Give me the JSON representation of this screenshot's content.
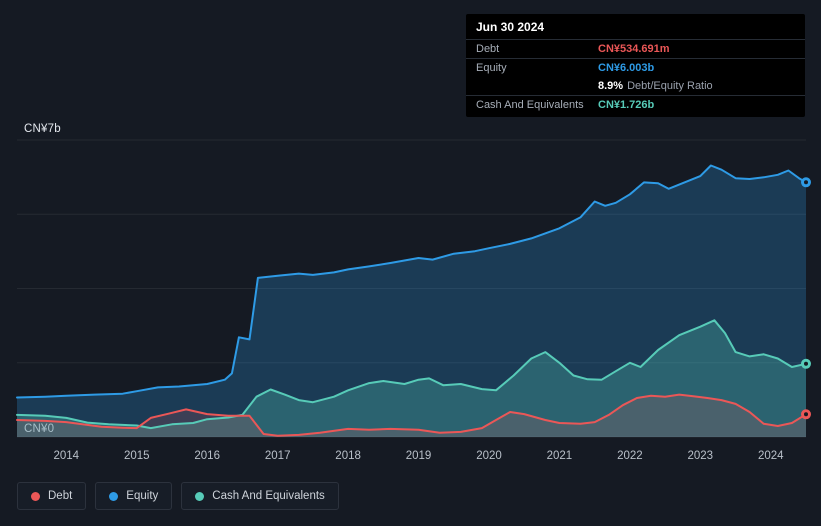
{
  "colors": {
    "background": "#151a23",
    "debt": "#eb5757",
    "equity": "#2e9be6",
    "cash": "#57cbb8",
    "grid": "rgba(255,255,255,0.07)",
    "tooltip_bg": "#000000",
    "tooltip_divider": "#262c35",
    "text_primary": "#ffffff",
    "text_muted": "#a7aeb8"
  },
  "tooltip": {
    "date": "Jun 30 2024",
    "rows": [
      {
        "label": "Debt",
        "value": "CN¥534.691m",
        "color_key": "debt"
      },
      {
        "label": "Equity",
        "value": "CN¥6.003b",
        "color_key": "equity"
      },
      {
        "label": "Cash And Equivalents",
        "value": "CN¥1.726b",
        "color_key": "cash"
      }
    ],
    "ratio_value": "8.9%",
    "ratio_label": "Debt/Equity Ratio"
  },
  "y_axis": {
    "top_label": "CN¥7b",
    "bottom_label": "CN¥0"
  },
  "legend": [
    {
      "label": "Debt",
      "color_key": "debt"
    },
    {
      "label": "Equity",
      "color_key": "equity"
    },
    {
      "label": "Cash And Equivalents",
      "color_key": "cash"
    }
  ],
  "chart_data": {
    "type": "area",
    "value_unit": "CN¥ billions",
    "x_range": [
      2013.3,
      2024.5
    ],
    "ylim": [
      0,
      7
    ],
    "gridline_values": [
      0,
      1.75,
      3.5,
      5.25,
      7
    ],
    "x_ticks": [
      2014,
      2015,
      2016,
      2017,
      2018,
      2019,
      2020,
      2021,
      2022,
      2023,
      2024
    ],
    "legend_position": "bottom-left",
    "series": [
      {
        "key": "equity",
        "name": "Equity",
        "color": "#2e9be6",
        "fill": "rgba(46,155,230,0.26)",
        "last_value_label": "CN¥6.003b",
        "points": [
          [
            2013.3,
            0.93
          ],
          [
            2013.7,
            0.95
          ],
          [
            2014.0,
            0.97
          ],
          [
            2014.4,
            1.0
          ],
          [
            2014.8,
            1.02
          ],
          [
            2015.0,
            1.08
          ],
          [
            2015.3,
            1.17
          ],
          [
            2015.6,
            1.19
          ],
          [
            2016.0,
            1.25
          ],
          [
            2016.25,
            1.35
          ],
          [
            2016.35,
            1.5
          ],
          [
            2016.45,
            2.35
          ],
          [
            2016.6,
            2.3
          ],
          [
            2016.72,
            3.75
          ],
          [
            2017.0,
            3.8
          ],
          [
            2017.3,
            3.85
          ],
          [
            2017.5,
            3.82
          ],
          [
            2017.8,
            3.88
          ],
          [
            2018.0,
            3.95
          ],
          [
            2018.3,
            4.02
          ],
          [
            2018.6,
            4.1
          ],
          [
            2019.0,
            4.22
          ],
          [
            2019.2,
            4.18
          ],
          [
            2019.5,
            4.32
          ],
          [
            2019.8,
            4.38
          ],
          [
            2020.0,
            4.45
          ],
          [
            2020.3,
            4.55
          ],
          [
            2020.6,
            4.68
          ],
          [
            2021.0,
            4.92
          ],
          [
            2021.3,
            5.18
          ],
          [
            2021.5,
            5.55
          ],
          [
            2021.65,
            5.45
          ],
          [
            2021.8,
            5.52
          ],
          [
            2022.0,
            5.72
          ],
          [
            2022.2,
            6.0
          ],
          [
            2022.4,
            5.98
          ],
          [
            2022.55,
            5.85
          ],
          [
            2022.7,
            5.95
          ],
          [
            2023.0,
            6.15
          ],
          [
            2023.15,
            6.4
          ],
          [
            2023.3,
            6.3
          ],
          [
            2023.5,
            6.1
          ],
          [
            2023.7,
            6.08
          ],
          [
            2023.9,
            6.12
          ],
          [
            2024.1,
            6.18
          ],
          [
            2024.25,
            6.28
          ],
          [
            2024.4,
            6.1
          ],
          [
            2024.5,
            6.003
          ]
        ]
      },
      {
        "key": "cash",
        "name": "Cash And Equivalents",
        "color": "#57cbb8",
        "fill": "rgba(87,203,184,0.28)",
        "last_value_label": "CN¥1.726b",
        "points": [
          [
            2013.3,
            0.52
          ],
          [
            2013.7,
            0.5
          ],
          [
            2014.0,
            0.45
          ],
          [
            2014.3,
            0.34
          ],
          [
            2014.6,
            0.3
          ],
          [
            2015.0,
            0.27
          ],
          [
            2015.2,
            0.21
          ],
          [
            2015.5,
            0.3
          ],
          [
            2015.8,
            0.33
          ],
          [
            2016.0,
            0.42
          ],
          [
            2016.3,
            0.46
          ],
          [
            2016.5,
            0.52
          ],
          [
            2016.7,
            0.95
          ],
          [
            2016.9,
            1.12
          ],
          [
            2017.1,
            1.0
          ],
          [
            2017.3,
            0.87
          ],
          [
            2017.5,
            0.82
          ],
          [
            2017.8,
            0.95
          ],
          [
            2018.0,
            1.1
          ],
          [
            2018.3,
            1.27
          ],
          [
            2018.5,
            1.32
          ],
          [
            2018.8,
            1.25
          ],
          [
            2019.0,
            1.35
          ],
          [
            2019.15,
            1.38
          ],
          [
            2019.35,
            1.22
          ],
          [
            2019.6,
            1.25
          ],
          [
            2019.9,
            1.13
          ],
          [
            2020.1,
            1.1
          ],
          [
            2020.35,
            1.45
          ],
          [
            2020.6,
            1.85
          ],
          [
            2020.8,
            2.0
          ],
          [
            2021.0,
            1.75
          ],
          [
            2021.2,
            1.45
          ],
          [
            2021.4,
            1.36
          ],
          [
            2021.6,
            1.35
          ],
          [
            2021.8,
            1.55
          ],
          [
            2022.0,
            1.75
          ],
          [
            2022.15,
            1.65
          ],
          [
            2022.4,
            2.05
          ],
          [
            2022.7,
            2.4
          ],
          [
            2023.0,
            2.6
          ],
          [
            2023.2,
            2.75
          ],
          [
            2023.35,
            2.45
          ],
          [
            2023.5,
            2.0
          ],
          [
            2023.7,
            1.9
          ],
          [
            2023.9,
            1.95
          ],
          [
            2024.1,
            1.85
          ],
          [
            2024.3,
            1.65
          ],
          [
            2024.5,
            1.726
          ]
        ]
      },
      {
        "key": "debt",
        "name": "Debt",
        "color": "#eb5757",
        "fill": "rgba(235,87,87,0.16)",
        "last_value_label": "CN¥534.691m",
        "points": [
          [
            2013.3,
            0.4
          ],
          [
            2013.7,
            0.38
          ],
          [
            2014.0,
            0.35
          ],
          [
            2014.5,
            0.24
          ],
          [
            2014.8,
            0.22
          ],
          [
            2015.0,
            0.21
          ],
          [
            2015.2,
            0.45
          ],
          [
            2015.45,
            0.55
          ],
          [
            2015.7,
            0.65
          ],
          [
            2016.0,
            0.54
          ],
          [
            2016.3,
            0.5
          ],
          [
            2016.6,
            0.5
          ],
          [
            2016.8,
            0.07
          ],
          [
            2017.0,
            0.03
          ],
          [
            2017.3,
            0.05
          ],
          [
            2017.6,
            0.1
          ],
          [
            2018.0,
            0.19
          ],
          [
            2018.3,
            0.17
          ],
          [
            2018.6,
            0.19
          ],
          [
            2019.0,
            0.17
          ],
          [
            2019.3,
            0.1
          ],
          [
            2019.6,
            0.12
          ],
          [
            2019.9,
            0.21
          ],
          [
            2020.1,
            0.4
          ],
          [
            2020.3,
            0.59
          ],
          [
            2020.5,
            0.54
          ],
          [
            2020.8,
            0.4
          ],
          [
            2021.0,
            0.33
          ],
          [
            2021.3,
            0.31
          ],
          [
            2021.5,
            0.35
          ],
          [
            2021.7,
            0.52
          ],
          [
            2021.9,
            0.75
          ],
          [
            2022.1,
            0.92
          ],
          [
            2022.3,
            0.97
          ],
          [
            2022.5,
            0.95
          ],
          [
            2022.7,
            1.0
          ],
          [
            2022.9,
            0.96
          ],
          [
            2023.1,
            0.92
          ],
          [
            2023.3,
            0.87
          ],
          [
            2023.5,
            0.78
          ],
          [
            2023.7,
            0.59
          ],
          [
            2023.9,
            0.31
          ],
          [
            2024.1,
            0.26
          ],
          [
            2024.3,
            0.33
          ],
          [
            2024.5,
            0.535
          ]
        ]
      }
    ]
  }
}
